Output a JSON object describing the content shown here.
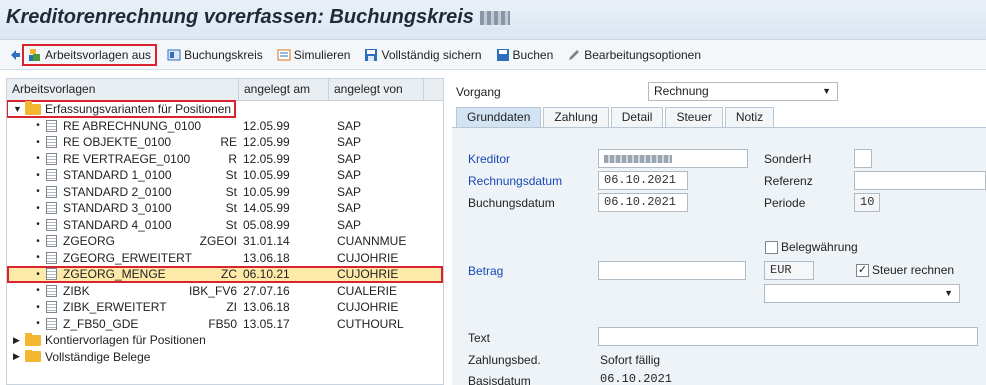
{
  "window": {
    "title": "Kreditorenrechnung vorerfassen: Buchungskreis"
  },
  "toolbar": {
    "items": [
      {
        "label": "Arbeitsvorlagen aus"
      },
      {
        "label": "Buchungskreis"
      },
      {
        "label": "Simulieren"
      },
      {
        "label": "Vollständig sichern"
      },
      {
        "label": "Buchen"
      },
      {
        "label": "Bearbeitungsoptionen"
      }
    ]
  },
  "tree": {
    "columns": [
      "Arbeitsvorlagen",
      "angelegt am",
      "angelegt von"
    ],
    "folder_open": "Erfassungsvarianten  für Positionen",
    "rows": [
      {
        "name": "RE ABRECHNUNG_0100",
        "clip": "",
        "date": "12.05.99",
        "user": "SAP"
      },
      {
        "name": "RE OBJEKTE_0100",
        "clip": "RE",
        "date": "12.05.99",
        "user": "SAP"
      },
      {
        "name": "RE VERTRAEGE_0100",
        "clip": "R",
        "date": "12.05.99",
        "user": "SAP"
      },
      {
        "name": "STANDARD 1_0100",
        "clip": "St",
        "date": "10.05.99",
        "user": "SAP"
      },
      {
        "name": "STANDARD 2_0100",
        "clip": "St",
        "date": "10.05.99",
        "user": "SAP"
      },
      {
        "name": "STANDARD 3_0100",
        "clip": "St",
        "date": "14.05.99",
        "user": "SAP"
      },
      {
        "name": "STANDARD 4_0100",
        "clip": "St",
        "date": "05.08.99",
        "user": "SAP"
      },
      {
        "name": "ZGEORG",
        "clip": "ZGEOI",
        "date": "31.01.14",
        "user": "CUANNMUE"
      },
      {
        "name": "ZGEORG_ERWEITERT",
        "clip": "",
        "date": "13.06.18",
        "user": "CUJOHRIE"
      },
      {
        "name": "ZGEORG_MENGE",
        "clip": "ZC",
        "date": "06.10.21",
        "user": "CUJOHRIE"
      },
      {
        "name": "ZIBK",
        "clip": "IBK_FV6",
        "date": "27.07.16",
        "user": "CUALERIE"
      },
      {
        "name": "ZIBK_ERWEITERT",
        "clip": "ZI",
        "date": "13.06.18",
        "user": "CUJOHRIE"
      },
      {
        "name": "Z_FB50_GDE",
        "clip": "FB50",
        "date": "13.05.17",
        "user": "CUTHOURL"
      }
    ],
    "folders_closed": [
      "Kontiervorlagen für Positionen",
      "Vollständige Belege"
    ]
  },
  "form": {
    "vorgang_label": "Vorgang",
    "vorgang_value": "Rechnung",
    "tabs": [
      "Grunddaten",
      "Zahlung",
      "Detail",
      "Steuer",
      "Notiz"
    ],
    "kreditor_label": "Kreditor",
    "rechnungsdatum_label": "Rechnungsdatum",
    "rechnungsdatum_value": "06.10.2021",
    "buchungsdatum_label": "Buchungsdatum",
    "buchungsdatum_value": "06.10.2021",
    "sonderh_label": "SonderH",
    "referenz_label": "Referenz",
    "periode_label": "Periode",
    "periode_value": "10",
    "belegwaehrung_label": "Belegwährung",
    "betrag_label": "Betrag",
    "currency_value": "EUR",
    "steuer_rechnen_label": "Steuer rechnen",
    "steuer_check": "✓",
    "text_label": "Text",
    "zahlungsbed_label": "Zahlungsbed.",
    "zahlungsbed_value": "Sofort fällig",
    "basisdatum_label": "Basisdatum",
    "basisdatum_value": "06.10.2021"
  }
}
